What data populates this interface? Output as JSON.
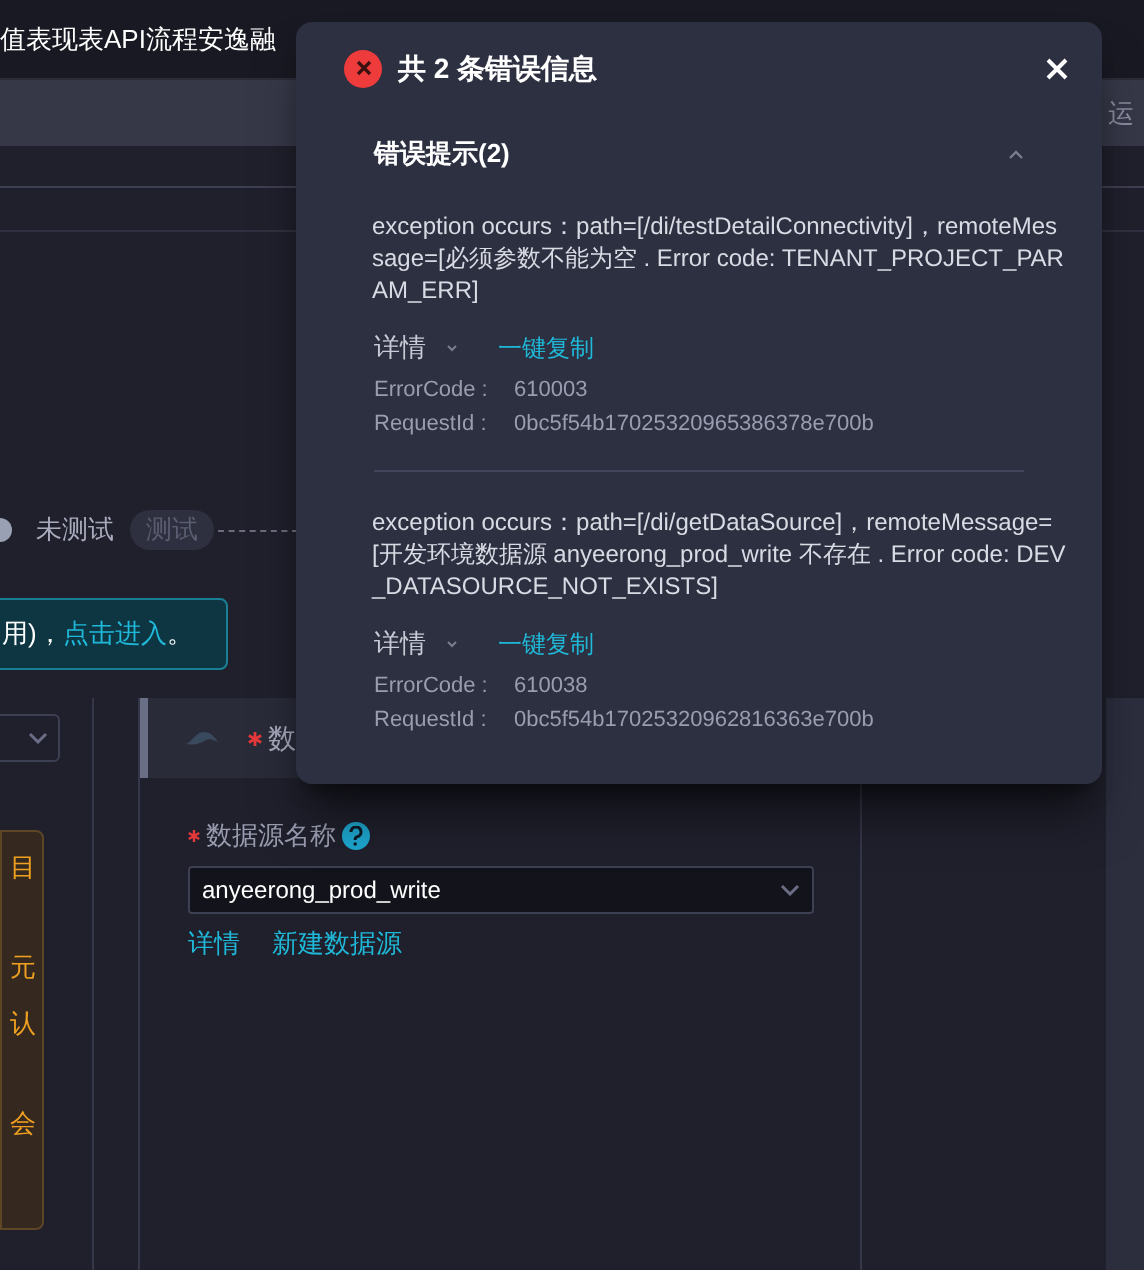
{
  "top_bar": {
    "title": "值表现表API流程安逸融"
  },
  "toolbar": {
    "tab": "运"
  },
  "test_status": {
    "state": "未测试",
    "button": "测试"
  },
  "notice": {
    "text": "用)，",
    "link": "点击进入",
    "end": "。"
  },
  "warning_box": {
    "lines": [
      "目",
      "元",
      "认",
      "会"
    ]
  },
  "card": {
    "title": "数",
    "required": true
  },
  "form": {
    "label": "数据源名称",
    "required": true,
    "value": "anyeerong_prod_write",
    "links": [
      "详情",
      "新建数据源"
    ]
  },
  "dialog": {
    "title": "共 2 条错误信息",
    "section": {
      "title": "错误提示(2)",
      "expanded": true,
      "errors": [
        {
          "message": "exception occurs：path=[/di/testDetailConnectivity]，remoteMessage=[必须参数不能为空 . Error code: TENANT_PROJECT_PARAM_ERR]",
          "details": "详情",
          "details_expanded": false,
          "copy": "一键复制",
          "error_code_label": "ErrorCode :",
          "error_code": "610003",
          "request_id_label": "RequestId :",
          "request_id": "0bc5f54b17025320965386378e700b"
        },
        {
          "message": "exception occurs：path=[/di/getDataSource]，remoteMessage=[开发环境数据源 anyeerong_prod_write 不存在 . Error code: DEV_DATASOURCE_NOT_EXISTS]",
          "details": "详情",
          "details_expanded": false,
          "copy": "一键复制",
          "error_code_label": "ErrorCode :",
          "error_code": "610038",
          "request_id_label": "RequestId :",
          "request_id": "0bc5f54b17025320962816363e700b"
        }
      ]
    }
  }
}
